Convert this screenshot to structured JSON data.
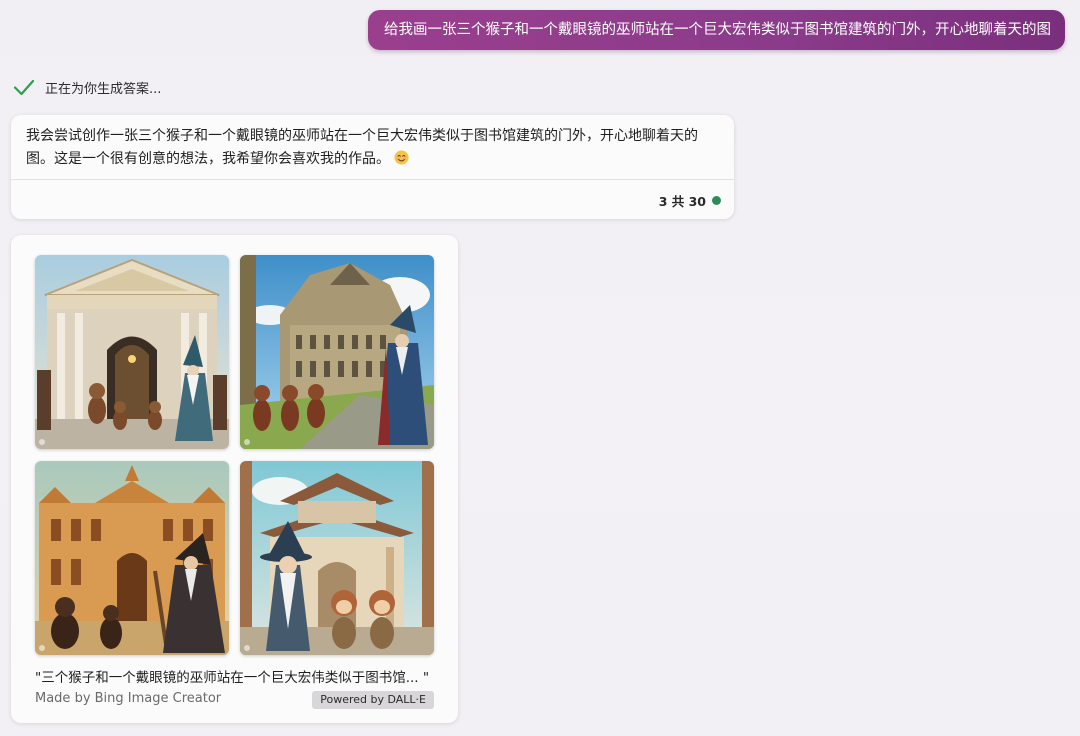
{
  "user_message": {
    "text": "给我画一张三个猴子和一个戴眼镜的巫师站在一个巨大宏伟类似于图书馆建筑的门外，开心地聊着天的图"
  },
  "status": {
    "text": "正在为你生成答案...",
    "icon": "check-icon",
    "color": "#2e9e4d"
  },
  "bot_message": {
    "text": "我会尝试创作一张三个猴子和一个戴眼镜的巫师站在一个巨大宏伟类似于图书馆建筑的门外，开心地聊着天的图。这是一个很有创意的想法，我希望你会喜欢我的作品。",
    "emoji": "smiling-face-emoji",
    "counter": "3 共 30",
    "counter_dot_color": "#2e8b57"
  },
  "image_card": {
    "images": [
      {
        "name": "generated-image-1",
        "scene": "white library facade, three monkeys and a wizard"
      },
      {
        "name": "generated-image-2",
        "scene": "palace under blue sky, three monkeys and a wizard"
      },
      {
        "name": "generated-image-3",
        "scene": "golden palace facade, monkeys and a wizard with staff"
      },
      {
        "name": "generated-image-4",
        "scene": "pagoda-style gate, wizard with glasses and two monkeys"
      }
    ],
    "caption": "\"三个猴子和一个戴眼镜的巫师站在一个巨大宏伟类似于图书馆... \"",
    "made_by": "Made by Bing Image Creator",
    "powered_by": "Powered by DALL·E"
  },
  "colors": {
    "user_bubble_accent": "#8a3b8a",
    "background": "#f2f0f4"
  }
}
